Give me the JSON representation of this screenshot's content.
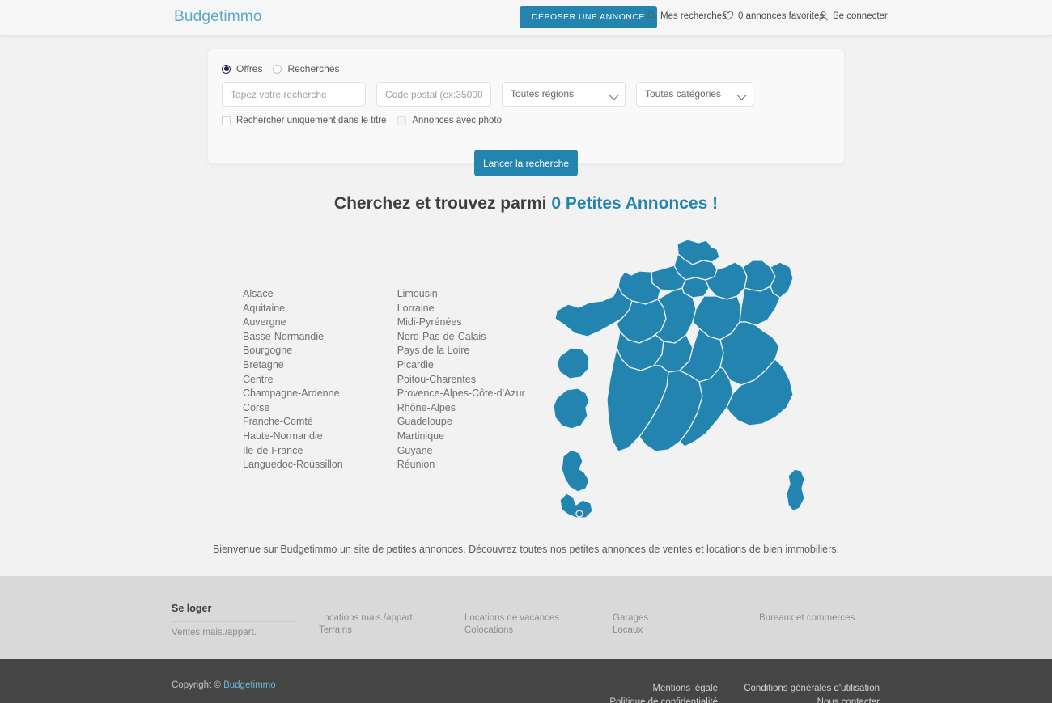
{
  "header": {
    "brand": "Budgetimmo",
    "cta_label": "DÉPOSER UNE ANNONCE",
    "cta_color": "#2484b0",
    "nav": [
      {
        "icon": "bell-icon",
        "label": "Mes recherches"
      },
      {
        "icon": "heart-icon",
        "label": "0 annonces favorites"
      },
      {
        "icon": "user-icon",
        "label": "Se connecter"
      }
    ]
  },
  "search": {
    "radios": [
      {
        "label": "Offres",
        "selected": true
      },
      {
        "label": "Recherches",
        "selected": false
      }
    ],
    "keyword_placeholder": "Tapez votre recherche",
    "keyword_value": "",
    "postal_placeholder": "Code postal (ex:35000)",
    "postal_value": "",
    "region_selected": "Toutes régions",
    "category_selected": "Toutes catégories",
    "checkboxes": [
      {
        "label": "Rechercher uniquement dans le titre",
        "checked": false
      },
      {
        "label": "Annonces avec photo",
        "checked": false
      }
    ],
    "submit_label": "Lancer la recherche"
  },
  "headline": {
    "prefix": "Cherchez et trouvez parmi ",
    "count_text": "0 Petites Annonces !",
    "accent_color": "#2484b0"
  },
  "regions": {
    "column_left": [
      "Alsace",
      "Aquitaine",
      "Auvergne",
      "Basse-Normandie",
      "Bourgogne",
      "Bretagne",
      "Centre",
      "Champagne-Ardenne",
      "Corse",
      "Franche-Comté",
      "Haute-Normandie",
      "Ile-de-France",
      "Languedoc-Roussillon"
    ],
    "column_right": [
      "Limousin",
      "Lorraine",
      "Midi-Pyrénées",
      "Nord-Pas-de-Calais",
      "Pays de la Loire",
      "Picardie",
      "Poitou-Charentes",
      "Provence-Alpes-Côte-d'Azur",
      "Rhône-Alpes",
      "Guadeloupe",
      "Martinique",
      "Guyane",
      "Réunion"
    ]
  },
  "map": {
    "name": "france-regions-map",
    "fill_color": "#2484b0",
    "stroke_color": "#e8f2f7"
  },
  "welcome_text": "Bienvenue sur Budgetimmo un site de petites annonces. Découvrez toutes nos petites annonces de ventes et locations de bien immobiliers.",
  "footer": {
    "columns": [
      {
        "heading": "Se loger",
        "links": [
          "Ventes mais./appart."
        ]
      },
      {
        "heading": "",
        "links": [
          "Locations mais./appart.",
          "Terrains"
        ]
      },
      {
        "heading": "",
        "links": [
          "Locations de vacances",
          "Colocations"
        ]
      },
      {
        "heading": "",
        "links": [
          "Garages",
          "Locaux"
        ]
      },
      {
        "heading": "",
        "links": [
          "Bureaux et commerces"
        ]
      }
    ],
    "copyright_prefix": "Copyright © ",
    "copyright_brand": "Budgetimmo",
    "legal_col_a": [
      "Mentions légale",
      "Politique de confidentialité"
    ],
    "legal_col_b": [
      "Conditions générales d'utilisation",
      "Nous contacter"
    ]
  }
}
